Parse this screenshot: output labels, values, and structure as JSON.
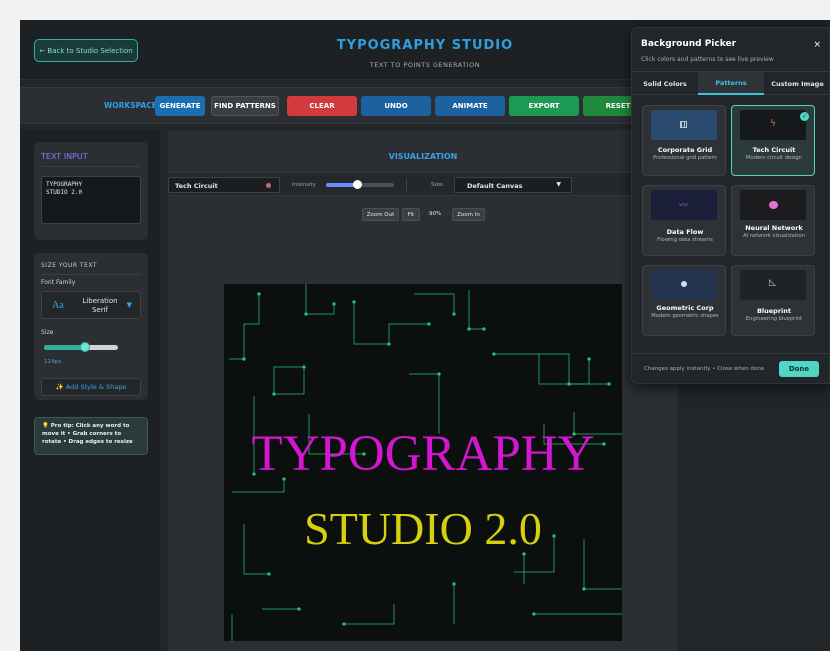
{
  "header": {
    "back_label": "← Back to Studio Selection",
    "title": "TYPOGRAPHY STUDIO",
    "subtitle": "TEXT TO POINTS GENERATION"
  },
  "workspace": {
    "label": "WORKSPACE:",
    "buttons": [
      {
        "label": "GENERATE",
        "color": "#1b6fb0"
      },
      {
        "label": "FIND PATTERNS",
        "color": "#3a3f44"
      },
      {
        "label": "CLEAR",
        "color": "#d33a3e"
      },
      {
        "label": "UNDO",
        "color": "#1d62a0"
      },
      {
        "label": "ANIMATE",
        "color": "#1d62a0"
      },
      {
        "label": "EXPORT",
        "color": "#1c9a53"
      },
      {
        "label": "RESET",
        "color": "#1f8a3c"
      }
    ]
  },
  "text_input": {
    "title": "TEXT INPUT",
    "value": "TYPOGRAPHY\nSTUDIO 2.0"
  },
  "size_panel": {
    "title": "SIZE YOUR TEXT",
    "font_family_label": "Font Family",
    "font_sample": "Aa",
    "font_name": "Liberation Serif",
    "size_label": "Size",
    "size_value": "124px",
    "size_fraction": 0.56,
    "add_style_label": "✨ Add Style & Shape"
  },
  "tip": "💡 Pro tip: Click any word to move it • Grab corners to rotate • Drag edges to resize",
  "visualization": {
    "title": "VISUALIZATION",
    "background_select": "Tech Circuit",
    "intensity_label": "Intensity",
    "intensity_fraction": 0.45,
    "size_label": "Size:",
    "canvas_select": "Default Canvas",
    "zoom_out": "Zoom Out",
    "fit": "Fit",
    "zoom_level": "90%",
    "zoom_in": "Zoom In"
  },
  "canvas": {
    "line1": "TYPOGRAPHY",
    "line2": "STUDIO 2.0",
    "line1_color": "#d316d0",
    "line2_color": "#d6d00e",
    "circuit_color": "#26c47a"
  },
  "picker": {
    "title": "Background Picker",
    "subtitle": "Click colors and patterns to see live preview",
    "close_icon": "×",
    "tabs": [
      "Solid Colors",
      "Patterns",
      "Custom Image"
    ],
    "active_tab": "Patterns",
    "patterns": [
      {
        "name": "Corporate Grid",
        "desc": "Professional grid pattern",
        "icon": "grid-icon",
        "thumb": "#2a4a70"
      },
      {
        "name": "Tech Circuit",
        "desc": "Modern circuit design",
        "icon": "bolt-icon",
        "thumb": "#15191b",
        "selected": true
      },
      {
        "name": "Data Flow",
        "desc": "Flowing data streams",
        "icon": "wave-icon",
        "thumb": "#1c1f3a"
      },
      {
        "name": "Neural Network",
        "desc": "AI network visualization",
        "icon": "brain-icon",
        "thumb": "#1a1c1e"
      },
      {
        "name": "Geometric Corp",
        "desc": "Modern geometric shapes",
        "icon": "circle-icon",
        "thumb": "#24344e"
      },
      {
        "name": "Blueprint",
        "desc": "Engineering blueprint",
        "icon": "ruler-icon",
        "thumb": "#1f2326"
      }
    ],
    "footer_note": "Changes apply instantly • Close when done",
    "done_label": "Done"
  }
}
